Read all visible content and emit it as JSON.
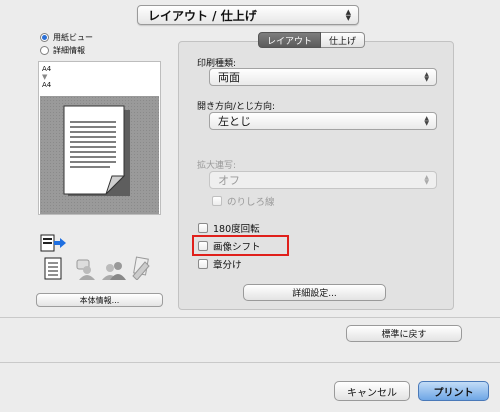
{
  "header": {
    "popup_label": "レイアウト / 仕上げ"
  },
  "preview": {
    "options": [
      {
        "label": "用紙ビュー",
        "selected": true
      },
      {
        "label": "詳細情報",
        "selected": false
      }
    ],
    "paper_from": "A4",
    "paper_to": "A4",
    "info_button": "本体情報..."
  },
  "tabs": [
    {
      "label": "レイアウト",
      "active": true
    },
    {
      "label": "仕上げ",
      "active": false
    }
  ],
  "layout": {
    "print_type_label": "印刷種類:",
    "print_type_value": "両面",
    "binding_label": "開き方向/とじ方向:",
    "binding_value": "左とじ",
    "scale_label": "拡大連写:",
    "scale_value": "オフ",
    "margin_line_label": "のりしろ線",
    "checkboxes": [
      {
        "label": "180度回転",
        "checked": false
      },
      {
        "label": "画像シフト",
        "checked": false
      },
      {
        "label": "章分け",
        "checked": false
      }
    ],
    "detail_button": "詳細設定..."
  },
  "footer": {
    "reset_button": "標準に戻す",
    "cancel_button": "キャンセル",
    "print_button": "プリント"
  },
  "colors": {
    "highlight": "#e0201b",
    "accent": "#6fa6e6"
  }
}
